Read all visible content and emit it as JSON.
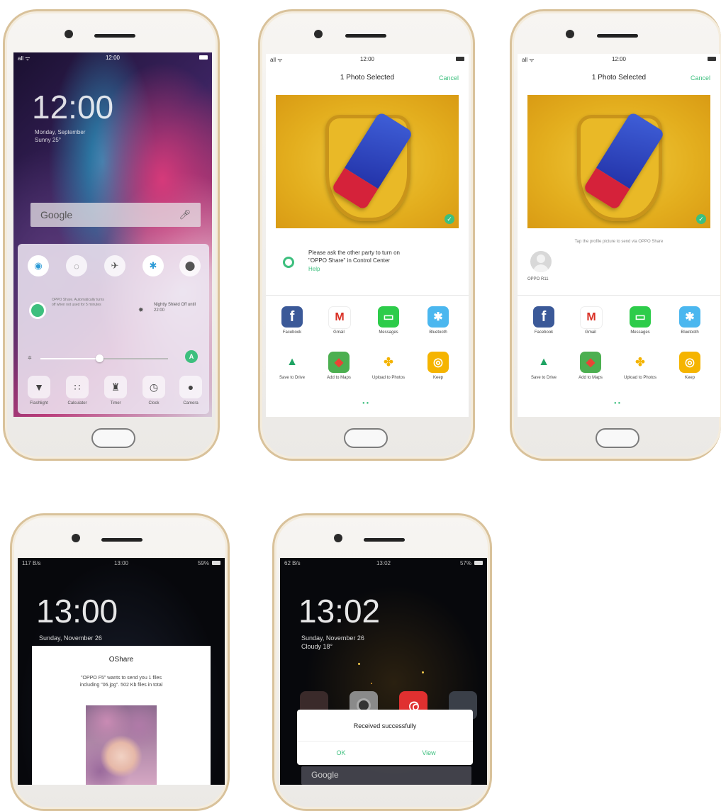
{
  "colors": {
    "accent_green": "#3dbf7e",
    "gold_frame": "#d9c29b",
    "facebook": "#3b5998",
    "bluetooth": "#4bb7ef",
    "keep": "#f5b400"
  },
  "phone1": {
    "status": {
      "time": "12:00",
      "signal": "all ᯤ"
    },
    "clock": "12:00",
    "date_line1": "Monday, September",
    "date_line2": "Sunny 25°",
    "search_label": "Google",
    "toggles": [
      {
        "icon": "wifi-icon",
        "glyph": "◉"
      },
      {
        "icon": "data-icon",
        "glyph": "◌"
      },
      {
        "icon": "airplane-icon",
        "glyph": "✈"
      },
      {
        "icon": "bluetooth-icon",
        "glyph": "✱"
      },
      {
        "icon": "location-icon",
        "glyph": "⬤"
      }
    ],
    "oppo_share_text": "OPPO Share. Automatically turns off when not used for 5 minutes",
    "night_shield_text": "Nightly Shield Off until 22:00",
    "brightness_auto": "A",
    "tiles": [
      {
        "label": "Flashlight",
        "icon": "flashlight-icon",
        "glyph": "▼"
      },
      {
        "label": "Calculator",
        "icon": "calculator-icon",
        "glyph": "∷"
      },
      {
        "label": "Timer",
        "icon": "rocket-icon",
        "glyph": "♜"
      },
      {
        "label": "Clock",
        "icon": "clock-icon",
        "glyph": "◷"
      },
      {
        "label": "Camera",
        "icon": "camera-icon",
        "glyph": "●"
      }
    ]
  },
  "phone2": {
    "status": {
      "time": "12:00"
    },
    "title": "1 Photo Selected",
    "cancel": "Cancel",
    "notice_line1": "Please ask the other party to turn on",
    "notice_line2": "\"OPPO Share\" in Control Center",
    "help": "Help",
    "apps": [
      {
        "label": "Facebook",
        "glyph": "f",
        "icon": "facebook-icon",
        "bg": "#3b5998"
      },
      {
        "label": "Gmail",
        "glyph": "M",
        "icon": "gmail-icon",
        "bg": "#ffffff"
      },
      {
        "label": "Messages",
        "glyph": "▭",
        "icon": "messages-icon",
        "bg": "#2dcc4a"
      },
      {
        "label": "Bluetooth",
        "glyph": "✱",
        "icon": "bluetooth-icon",
        "bg": "#4bb7ef"
      },
      {
        "label": "Save to Drive",
        "glyph": "▲",
        "icon": "drive-icon",
        "bg": "#ffffff"
      },
      {
        "label": "Add to Maps",
        "glyph": "◆",
        "icon": "maps-icon",
        "bg": "#4caf50"
      },
      {
        "label": "Upload to Photos",
        "glyph": "✤",
        "icon": "photos-icon",
        "bg": "#ffffff"
      },
      {
        "label": "Keep",
        "glyph": "◎",
        "icon": "keep-icon",
        "bg": "#f5b400"
      }
    ]
  },
  "phone3": {
    "status": {
      "time": "12:00"
    },
    "title": "1 Photo Selected",
    "cancel": "Cancel",
    "tap_hint": "Tap the profile picture to send via OPPO Share",
    "device_name": "OPPO R11",
    "apps": [
      {
        "label": "Facebook",
        "glyph": "f",
        "icon": "facebook-icon",
        "bg": "#3b5998"
      },
      {
        "label": "Gmail",
        "glyph": "M",
        "icon": "gmail-icon",
        "bg": "#ffffff"
      },
      {
        "label": "Messages",
        "glyph": "▭",
        "icon": "messages-icon",
        "bg": "#2dcc4a"
      },
      {
        "label": "Bluetooth",
        "glyph": "✱",
        "icon": "bluetooth-icon",
        "bg": "#4bb7ef"
      },
      {
        "label": "Save to Drive",
        "glyph": "▲",
        "icon": "drive-icon",
        "bg": "#ffffff"
      },
      {
        "label": "Add to Maps",
        "glyph": "◆",
        "icon": "maps-icon",
        "bg": "#4caf50"
      },
      {
        "label": "Upload to Photos",
        "glyph": "✤",
        "icon": "photos-icon",
        "bg": "#ffffff"
      },
      {
        "label": "Keep",
        "glyph": "◎",
        "icon": "keep-icon",
        "bg": "#f5b400"
      }
    ]
  },
  "phone4": {
    "status": {
      "left": "117 B/s",
      "time": "13:00",
      "right": "59%"
    },
    "clock": "13:00",
    "date": "Sunday, November 26",
    "dialog_title": "OShare",
    "dialog_line1": "\"OPPO F5\" wants to send you 1 files",
    "dialog_line2": "including \"06.jpg\". 502 Kb files in total"
  },
  "phone5": {
    "status": {
      "left": "62 B/s",
      "time": "13:02",
      "right": "57%"
    },
    "clock": "13:02",
    "date": "Sunday, November 26",
    "weather": "Cloudy 18°",
    "dialog_title": "Received successfully",
    "ok": "OK",
    "view": "View",
    "search_label": "Google"
  }
}
